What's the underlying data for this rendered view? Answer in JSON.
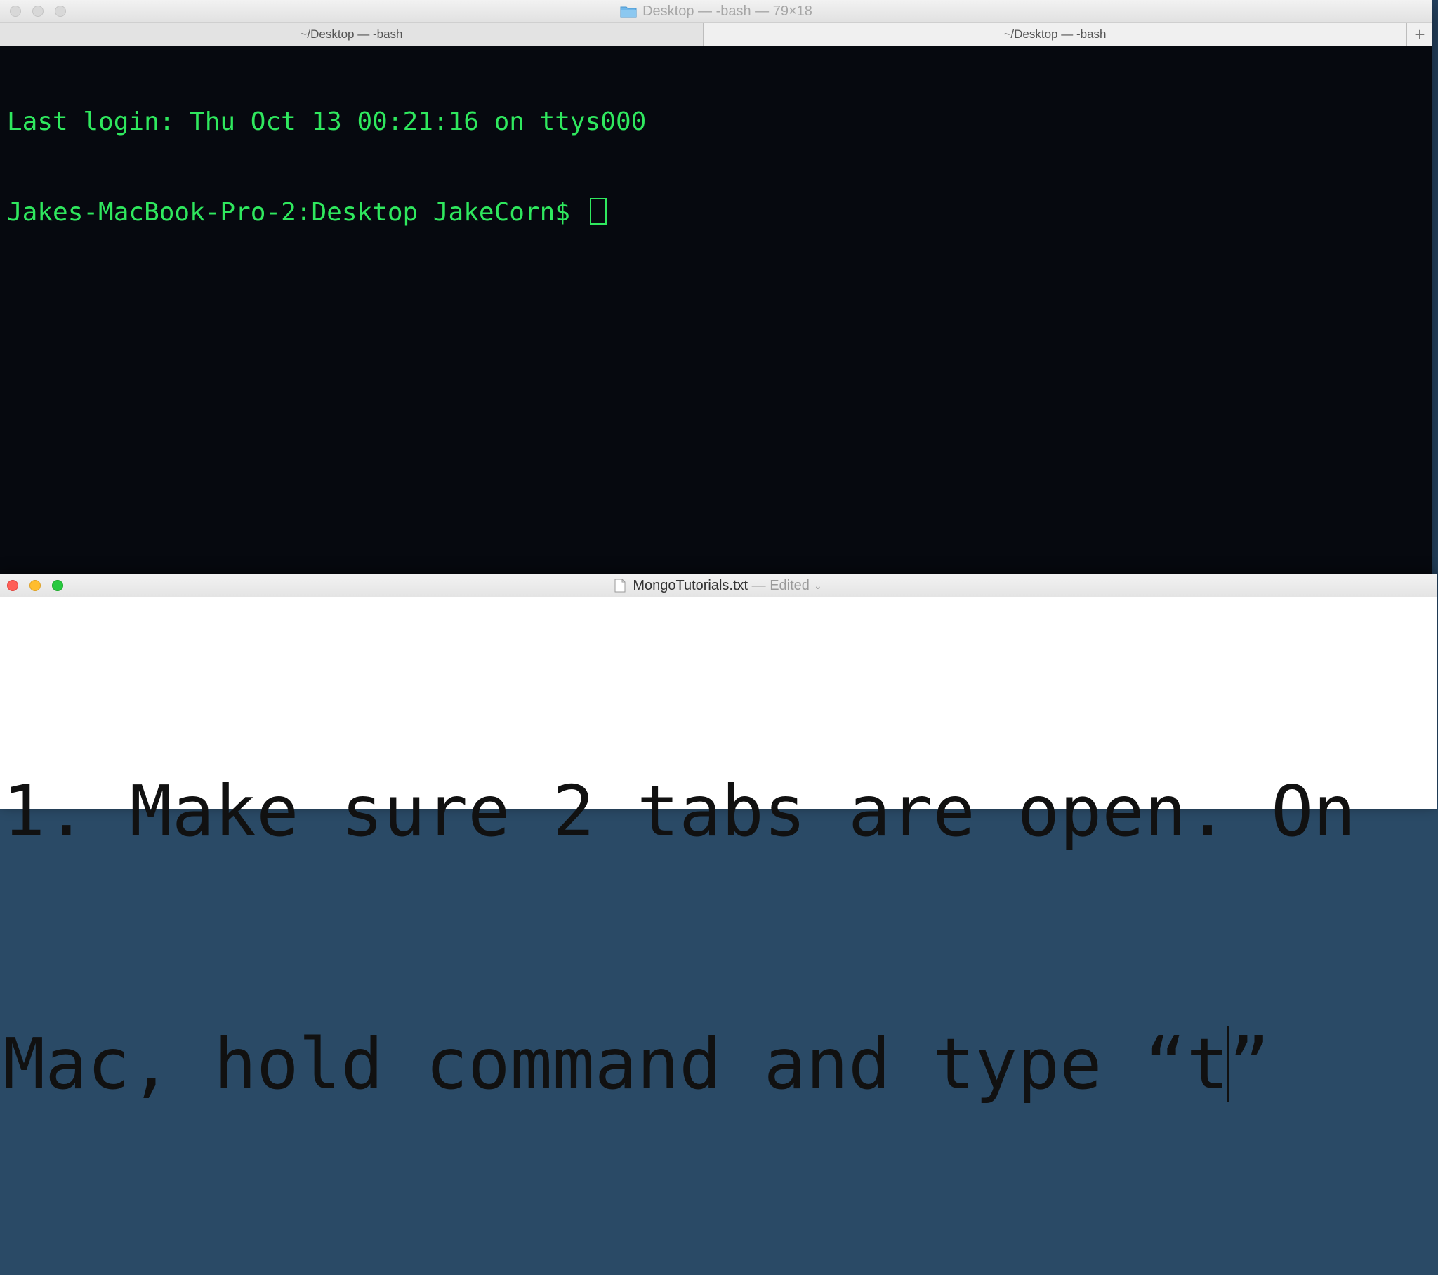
{
  "terminal": {
    "window_title": "Desktop — -bash — 79×18",
    "tabs": [
      {
        "label": "~/Desktop — -bash"
      },
      {
        "label": "~/Desktop — -bash"
      }
    ],
    "add_tab_symbol": "+",
    "lines": [
      "Last login: Thu Oct 13 00:21:16 on ttys000",
      "Jakes-MacBook-Pro-2:Desktop JakeCorn$ "
    ],
    "colors": {
      "text": "#2fe85e",
      "background": "#06090f"
    }
  },
  "textedit": {
    "filename": "MongoTutorials.txt",
    "separator": " — ",
    "status": "Edited",
    "status_chevron": "⌄",
    "line1": "1. Make sure 2 tabs are open. On",
    "line2_before_caret": "Mac, hold command and type “t",
    "line2_after_caret": "”"
  },
  "traffic_lights": {
    "close": "#ff5f57",
    "minimize": "#ffbd2e",
    "zoom": "#28c940"
  }
}
